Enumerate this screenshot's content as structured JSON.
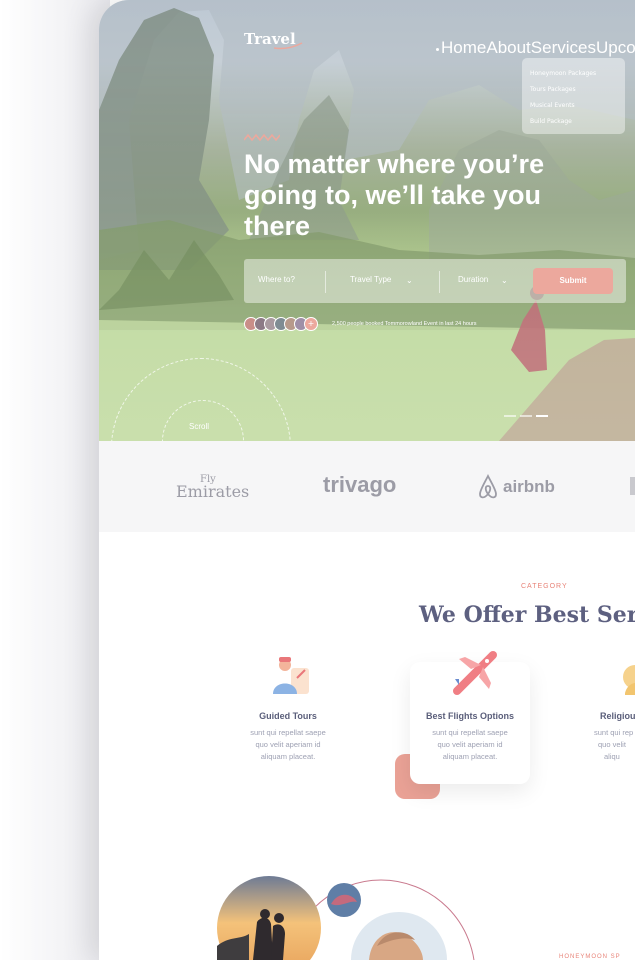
{
  "header": {
    "logo": "Travel",
    "nav": [
      "Home",
      "About",
      "Services",
      "Upcom"
    ],
    "services_menu": [
      "Honeymoon Packages",
      "Tours Packages",
      "Musical Events",
      "Build Package"
    ]
  },
  "hero": {
    "headline": "No matter where you’re going to, we’ll take you there",
    "search": {
      "where": "Where to?",
      "travel_type": "Travel Type",
      "duration": "Duration",
      "submit": "Submit"
    },
    "booked_text": "2,500 people booked Tommorowland Event in last 24 hours",
    "avatars_plus": "+",
    "scroll_label": "Scroll"
  },
  "brands": {
    "emirates_top": "Fly",
    "emirates_bottom": "Emirates",
    "trivago": "trivago",
    "airbnb": "airbnb"
  },
  "category": {
    "label": "CATEGORY",
    "title": "We Offer Best Servic",
    "services": [
      {
        "title": "Guided Tours",
        "desc": [
          "sunt qui repellat saepe",
          "quo velit aperiam id",
          "aliquam placeat."
        ]
      },
      {
        "title": "Best Flights Options",
        "desc": [
          "sunt qui repellat saepe",
          "quo velit aperiam id",
          "aliquam placeat."
        ]
      },
      {
        "title": "Religiou",
        "desc": [
          "sunt qui rep",
          "quo velit",
          "aliqu"
        ]
      }
    ]
  },
  "honeymoon": {
    "label": "HONEYMOON SP"
  },
  "colors": {
    "accent": "#eca89d",
    "heading": "#5d6080",
    "text_muted": "#9ea1b3"
  }
}
